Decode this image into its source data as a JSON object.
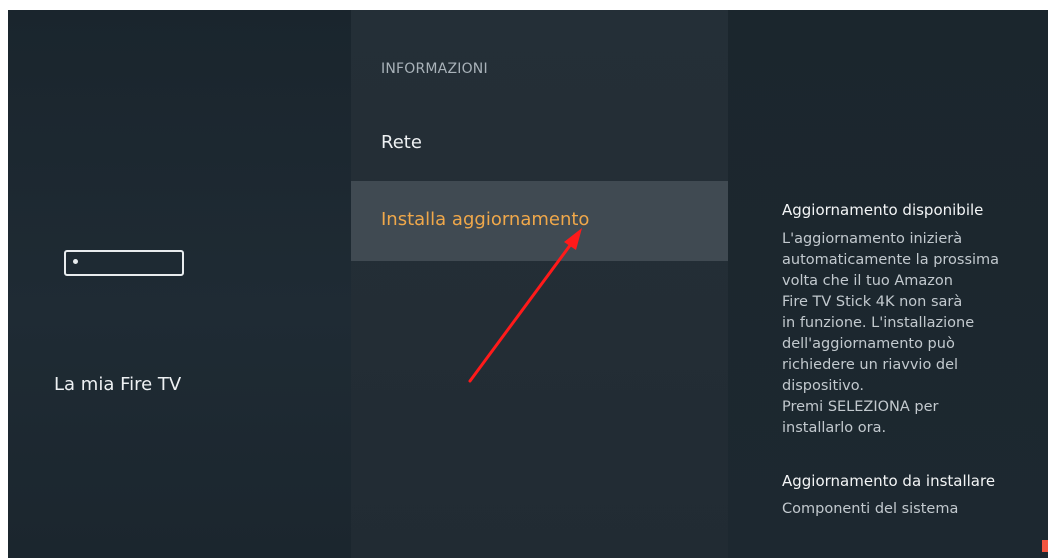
{
  "device_panel": {
    "icon": "fire-tv-stick-icon",
    "label": "La mia Fire TV"
  },
  "menu": {
    "section_header": "INFORMAZIONI",
    "items": [
      {
        "label": "Rete",
        "selected": false
      },
      {
        "label": "Installa aggiornamento",
        "selected": true
      }
    ]
  },
  "details": {
    "title": "Aggiornamento disponibile",
    "description_lines": [
      "L'aggiornamento inizierà",
      "automaticamente la prossima",
      "volta che il tuo Amazon",
      "Fire TV Stick 4K non sarà",
      "in funzione. L'installazione",
      "dell'aggiornamento può",
      "richiedere un riavvio del",
      "dispositivo.",
      "Premi SELEZIONA per",
      "installarlo ora."
    ],
    "pending_title": "Aggiornamento da installare",
    "pending_value": "Componenti del sistema"
  },
  "colors": {
    "accent_selected": "#f0a84a",
    "annotation_arrow": "#ff1a1a"
  }
}
